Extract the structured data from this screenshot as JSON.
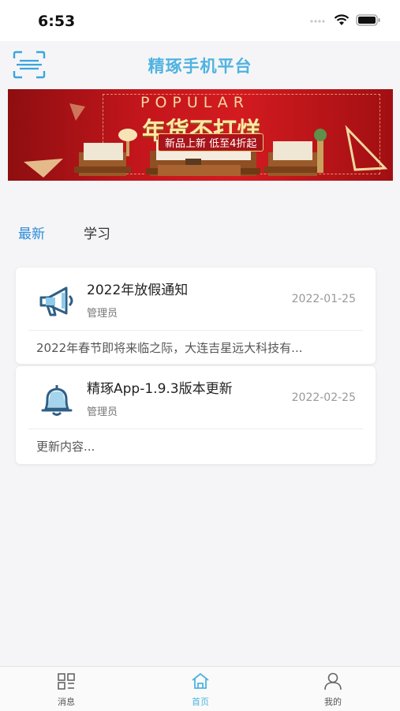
{
  "status_bar": {
    "time": "6:53"
  },
  "header": {
    "title": "精琢手机平台",
    "scan_icon": "scan-icon"
  },
  "banner": {
    "popular_text": "POPULAR",
    "headline": "年货不打烊",
    "subline": "新品上新  低至4折起"
  },
  "tabs": [
    {
      "label": "最新",
      "active": true
    },
    {
      "label": "学习",
      "active": false
    }
  ],
  "notices": [
    {
      "icon": "megaphone-icon",
      "title": "2022年放假通知",
      "author": "管理员",
      "date": "2022-01-25",
      "summary": "2022年春节即将来临之际，大连吉星远大科技有..."
    },
    {
      "icon": "bell-icon",
      "title": "精琢App-1.9.3版本更新",
      "author": "管理员",
      "date": "2022-02-25",
      "summary": "更新内容..."
    }
  ],
  "bottom_nav": [
    {
      "label": "消息",
      "icon": "grid-icon",
      "active": false
    },
    {
      "label": "首页",
      "icon": "home-icon",
      "active": true
    },
    {
      "label": "我的",
      "icon": "user-icon",
      "active": false
    }
  ],
  "colors": {
    "accent": "#4fb3e0",
    "tab_active": "#2d8cd9",
    "banner_red": "#c4161c"
  }
}
